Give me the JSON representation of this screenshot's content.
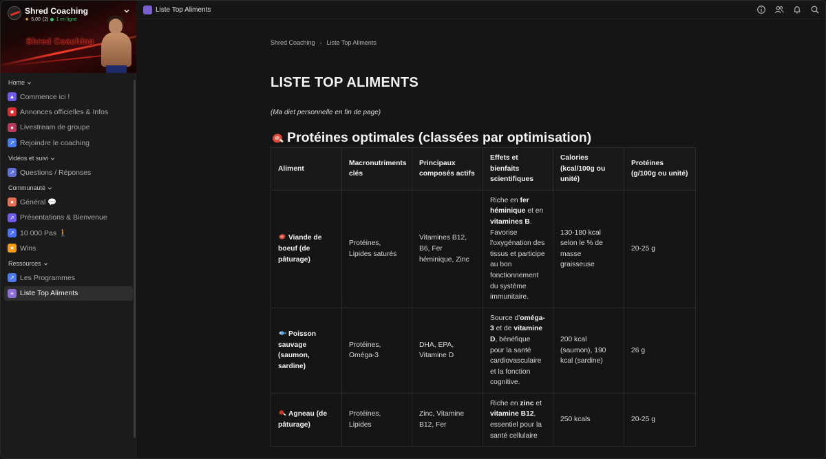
{
  "sidebar": {
    "app_title": "Shred Coaching",
    "rating": "5,00",
    "rating_count": "(2)",
    "online": "1 en ligne",
    "banner_logo": "Shred Coaching",
    "sections": [
      {
        "label": "Home",
        "items": [
          {
            "label": "Commence ici !",
            "icon": "graduation-cap-icon",
            "color": "#6c5ce7"
          },
          {
            "label": "Annonces officielles & Infos",
            "icon": "megaphone-icon",
            "color": "#d63031"
          },
          {
            "label": "Livestream de groupe",
            "icon": "record-icon",
            "color": "#b83b5e"
          },
          {
            "label": "Rejoindre le coaching",
            "icon": "link-icon",
            "color": "#4b7bec"
          }
        ]
      },
      {
        "label": "Vidéos et suivi",
        "items": [
          {
            "label": "Questions / Réponses",
            "icon": "chart-icon",
            "color": "#5f6fd6"
          }
        ]
      },
      {
        "label": "Communauté",
        "items": [
          {
            "label": "Général 💬",
            "icon": "chat-icon",
            "color": "#e17055"
          },
          {
            "label": "Présentations & Bienvenue",
            "icon": "chart-icon",
            "color": "#6c5ce7"
          },
          {
            "label": "10 000 Pas 🚶",
            "icon": "chart-icon",
            "color": "#4b6ef0"
          },
          {
            "label": "Wins",
            "icon": "trophy-icon",
            "color": "#f39c12"
          }
        ]
      },
      {
        "label": "Ressources",
        "items": [
          {
            "label": "Les Programmes",
            "icon": "chart-icon",
            "color": "#4b7bec"
          },
          {
            "label": "Liste Top Aliments",
            "icon": "list-icon",
            "color": "#8e6fd8",
            "active": true
          }
        ]
      }
    ]
  },
  "topbar": {
    "tab_title": "Liste Top Aliments"
  },
  "breadcrumb": {
    "root": "Shred Coaching",
    "current": "Liste Top Aliments"
  },
  "page": {
    "title": "LISTE TOP ALIMENTS",
    "intro": "(Ma diet personnelle en fin de page)",
    "section_heading": "Protéines optimales (classées par optimisation)"
  },
  "table": {
    "headers": [
      "Aliment",
      "Macronutriments clés",
      "Principaux composés actifs",
      "Effets et bienfaits scientifiques",
      "Calories (kcal/100g ou unité)",
      "Protéines (g/100g ou unité)"
    ],
    "rows": [
      {
        "food": "Viande de boeuf (de pâturage)",
        "icon": "meat-icon",
        "macros": "Protéines, Lipides saturés",
        "compounds": "Vitamines B12, B6, Fer héminique, Zinc",
        "effects_parts": [
          "Riche en ",
          "fer héminique",
          " et en ",
          "vitamines B",
          ". Favorise l'oxygénation des tissus et participe au bon fonctionnement du système immunitaire."
        ],
        "calories": "130-180 kcal selon le % de masse graisseuse",
        "protein": "20-25 g"
      },
      {
        "food": "Poisson sauvage (saumon, sardine)",
        "icon": "fish-icon",
        "macros": "Protéines, Oméga-3",
        "compounds": "DHA, EPA, Vitamine D",
        "effects_parts": [
          "Source d'",
          "oméga-3",
          " et de ",
          "vitamine D",
          ", bénéfique pour la santé cardiovasculaire et la fonction cognitive."
        ],
        "calories": "200 kcal (saumon), 190 kcal (sardine)",
        "protein": "26 g"
      },
      {
        "food": "Agneau (de pâturage)",
        "icon": "meat-leg-icon",
        "macros": "Protéines, Lipides",
        "compounds": "Zinc, Vitamine B12, Fer",
        "effects_parts": [
          "Riche en ",
          "zinc",
          " et ",
          "vitamine B12",
          ", essentiel pour la santé cellulaire"
        ],
        "calories": "250 kcals",
        "protein": "20-25 g"
      }
    ]
  },
  "colors": {
    "background": "#151515",
    "sidebar": "#1b1b1b",
    "active_item": "#2e2e2e",
    "accent": "#7b5fd1"
  }
}
